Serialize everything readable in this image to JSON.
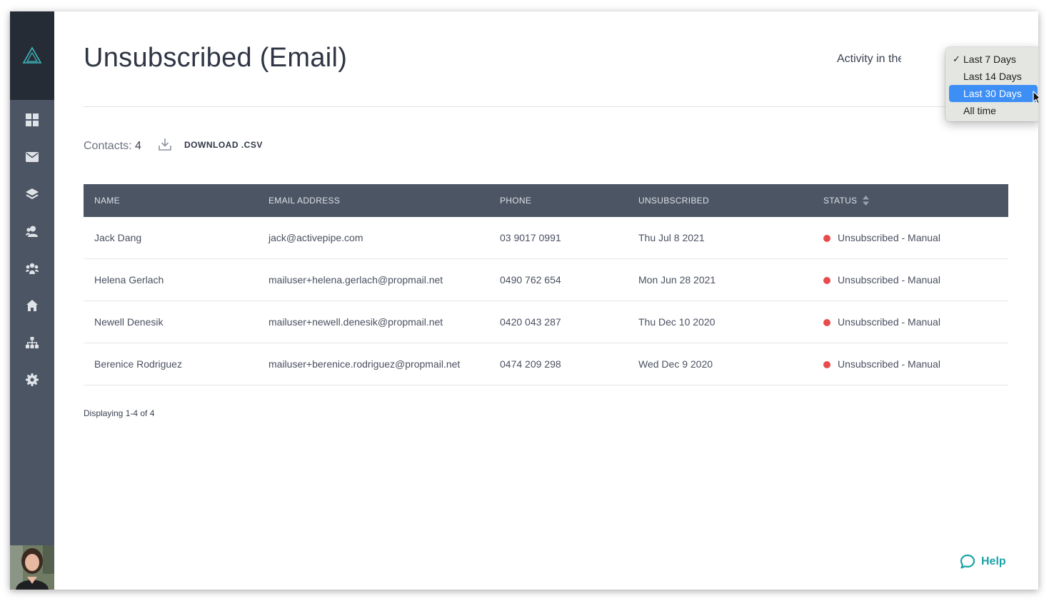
{
  "page": {
    "title": "Unsubscribed (Email)",
    "activity_label": "Activity in the"
  },
  "sidebar": {
    "logo": "activepipe-logo-icon",
    "items": [
      {
        "icon": "dashboard-grid-icon"
      },
      {
        "icon": "envelope-icon"
      },
      {
        "icon": "layers-icon"
      },
      {
        "icon": "contacts-icon"
      },
      {
        "icon": "group-icon"
      },
      {
        "icon": "home-icon"
      },
      {
        "icon": "org-chart-icon"
      },
      {
        "icon": "gear-icon"
      }
    ],
    "avatar": "user-avatar"
  },
  "summary": {
    "contacts_label": "Contacts:",
    "contacts_count": "4",
    "download_label": "DOWNLOAD .CSV"
  },
  "table": {
    "columns": [
      "NAME",
      "EMAIL ADDRESS",
      "PHONE",
      "UNSUBSCRIBED",
      "STATUS"
    ],
    "rows": [
      {
        "name": "Jack Dang",
        "email": "jack@activepipe.com",
        "phone": "03 9017 0991",
        "unsubscribed": "Thu Jul 8 2021",
        "status": "Unsubscribed - Manual"
      },
      {
        "name": "Helena Gerlach",
        "email": "mailuser+helena.gerlach@propmail.net",
        "phone": "0490 762 654",
        "unsubscribed": "Mon Jun 28 2021",
        "status": "Unsubscribed - Manual"
      },
      {
        "name": "Newell Denesik",
        "email": "mailuser+newell.denesik@propmail.net",
        "phone": "0420 043 287",
        "unsubscribed": "Thu Dec 10 2020",
        "status": "Unsubscribed - Manual"
      },
      {
        "name": "Berenice Rodriguez",
        "email": "mailuser+berenice.rodriguez@propmail.net",
        "phone": "0474 209 298",
        "unsubscribed": "Wed Dec 9 2020",
        "status": "Unsubscribed - Manual"
      }
    ],
    "status_color": "#e84b4b"
  },
  "pagination": {
    "text": "Displaying 1-4 of 4"
  },
  "dropdown": {
    "options": [
      "Last 7 Days",
      "Last 14 Days",
      "Last 30 Days",
      "All time"
    ],
    "checked": "Last 7 Days",
    "highlighted": "Last 30 Days",
    "check_mark": "✓"
  },
  "help": {
    "label": "Help",
    "color": "#1aa3a8"
  },
  "colors": {
    "sidebar": "#4b5563",
    "sidebar_top": "#262c36",
    "table_header": "#4b5563",
    "highlight": "#3d8ff5"
  }
}
